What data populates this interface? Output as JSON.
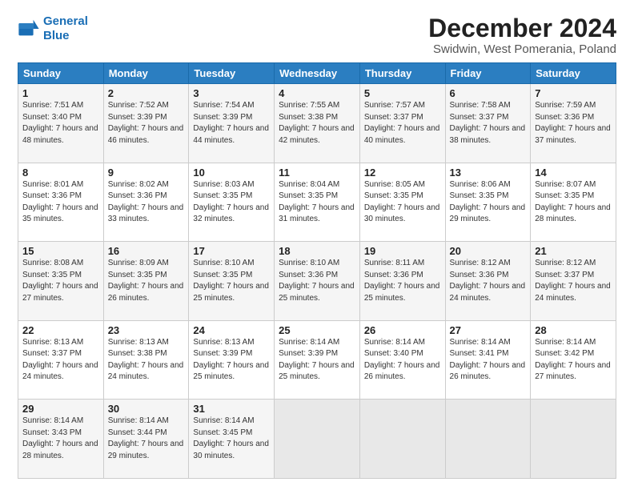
{
  "logo": {
    "line1": "General",
    "line2": "Blue"
  },
  "title": "December 2024",
  "subtitle": "Swidwin, West Pomerania, Poland",
  "days_of_week": [
    "Sunday",
    "Monday",
    "Tuesday",
    "Wednesday",
    "Thursday",
    "Friday",
    "Saturday"
  ],
  "weeks": [
    [
      {
        "day": 1,
        "sunrise": "7:51 AM",
        "sunset": "3:40 PM",
        "daylight": "7 hours and 48 minutes."
      },
      {
        "day": 2,
        "sunrise": "7:52 AM",
        "sunset": "3:39 PM",
        "daylight": "7 hours and 46 minutes."
      },
      {
        "day": 3,
        "sunrise": "7:54 AM",
        "sunset": "3:39 PM",
        "daylight": "7 hours and 44 minutes."
      },
      {
        "day": 4,
        "sunrise": "7:55 AM",
        "sunset": "3:38 PM",
        "daylight": "7 hours and 42 minutes."
      },
      {
        "day": 5,
        "sunrise": "7:57 AM",
        "sunset": "3:37 PM",
        "daylight": "7 hours and 40 minutes."
      },
      {
        "day": 6,
        "sunrise": "7:58 AM",
        "sunset": "3:37 PM",
        "daylight": "7 hours and 38 minutes."
      },
      {
        "day": 7,
        "sunrise": "7:59 AM",
        "sunset": "3:36 PM",
        "daylight": "7 hours and 37 minutes."
      }
    ],
    [
      {
        "day": 8,
        "sunrise": "8:01 AM",
        "sunset": "3:36 PM",
        "daylight": "7 hours and 35 minutes."
      },
      {
        "day": 9,
        "sunrise": "8:02 AM",
        "sunset": "3:36 PM",
        "daylight": "7 hours and 33 minutes."
      },
      {
        "day": 10,
        "sunrise": "8:03 AM",
        "sunset": "3:35 PM",
        "daylight": "7 hours and 32 minutes."
      },
      {
        "day": 11,
        "sunrise": "8:04 AM",
        "sunset": "3:35 PM",
        "daylight": "7 hours and 31 minutes."
      },
      {
        "day": 12,
        "sunrise": "8:05 AM",
        "sunset": "3:35 PM",
        "daylight": "7 hours and 30 minutes."
      },
      {
        "day": 13,
        "sunrise": "8:06 AM",
        "sunset": "3:35 PM",
        "daylight": "7 hours and 29 minutes."
      },
      {
        "day": 14,
        "sunrise": "8:07 AM",
        "sunset": "3:35 PM",
        "daylight": "7 hours and 28 minutes."
      }
    ],
    [
      {
        "day": 15,
        "sunrise": "8:08 AM",
        "sunset": "3:35 PM",
        "daylight": "7 hours and 27 minutes."
      },
      {
        "day": 16,
        "sunrise": "8:09 AM",
        "sunset": "3:35 PM",
        "daylight": "7 hours and 26 minutes."
      },
      {
        "day": 17,
        "sunrise": "8:10 AM",
        "sunset": "3:35 PM",
        "daylight": "7 hours and 25 minutes."
      },
      {
        "day": 18,
        "sunrise": "8:10 AM",
        "sunset": "3:36 PM",
        "daylight": "7 hours and 25 minutes."
      },
      {
        "day": 19,
        "sunrise": "8:11 AM",
        "sunset": "3:36 PM",
        "daylight": "7 hours and 25 minutes."
      },
      {
        "day": 20,
        "sunrise": "8:12 AM",
        "sunset": "3:36 PM",
        "daylight": "7 hours and 24 minutes."
      },
      {
        "day": 21,
        "sunrise": "8:12 AM",
        "sunset": "3:37 PM",
        "daylight": "7 hours and 24 minutes."
      }
    ],
    [
      {
        "day": 22,
        "sunrise": "8:13 AM",
        "sunset": "3:37 PM",
        "daylight": "7 hours and 24 minutes."
      },
      {
        "day": 23,
        "sunrise": "8:13 AM",
        "sunset": "3:38 PM",
        "daylight": "7 hours and 24 minutes."
      },
      {
        "day": 24,
        "sunrise": "8:13 AM",
        "sunset": "3:39 PM",
        "daylight": "7 hours and 25 minutes."
      },
      {
        "day": 25,
        "sunrise": "8:14 AM",
        "sunset": "3:39 PM",
        "daylight": "7 hours and 25 minutes."
      },
      {
        "day": 26,
        "sunrise": "8:14 AM",
        "sunset": "3:40 PM",
        "daylight": "7 hours and 26 minutes."
      },
      {
        "day": 27,
        "sunrise": "8:14 AM",
        "sunset": "3:41 PM",
        "daylight": "7 hours and 26 minutes."
      },
      {
        "day": 28,
        "sunrise": "8:14 AM",
        "sunset": "3:42 PM",
        "daylight": "7 hours and 27 minutes."
      }
    ],
    [
      {
        "day": 29,
        "sunrise": "8:14 AM",
        "sunset": "3:43 PM",
        "daylight": "7 hours and 28 minutes."
      },
      {
        "day": 30,
        "sunrise": "8:14 AM",
        "sunset": "3:44 PM",
        "daylight": "7 hours and 29 minutes."
      },
      {
        "day": 31,
        "sunrise": "8:14 AM",
        "sunset": "3:45 PM",
        "daylight": "7 hours and 30 minutes."
      },
      null,
      null,
      null,
      null
    ]
  ]
}
